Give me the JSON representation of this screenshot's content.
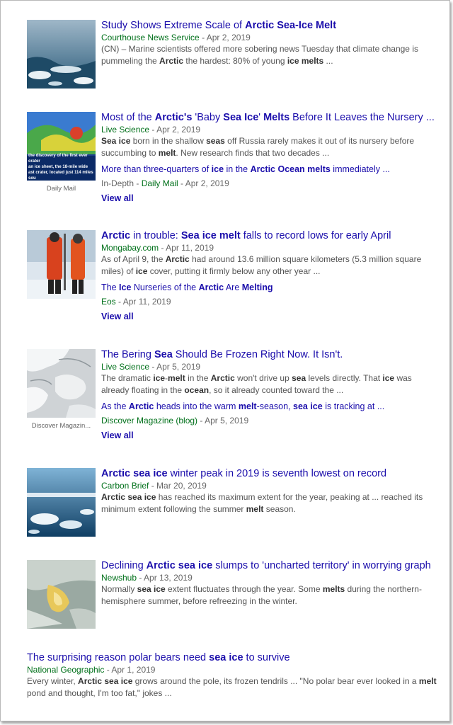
{
  "results": [
    {
      "title_parts": [
        [
          "Study Shows Extreme Scale of ",
          false
        ],
        [
          "Arctic Sea-Ice Melt",
          true
        ]
      ],
      "publisher": "Courthouse News Service",
      "date": "Apr 2, 2019",
      "snippet_parts": [
        [
          "(CN) – Marine scientists offered more sobering news Tuesday that climate change is pummeling the ",
          false
        ],
        [
          "Arctic",
          true
        ],
        [
          " the hardest: 80% of young ",
          false
        ],
        [
          "ice melts",
          true
        ],
        [
          " ...",
          false
        ]
      ]
    },
    {
      "title_parts": [
        [
          "Most of the ",
          false
        ],
        [
          "Arctic's",
          true
        ],
        [
          " 'Baby ",
          false
        ],
        [
          "Sea Ice",
          true
        ],
        [
          "' ",
          false
        ],
        [
          "Melts",
          true
        ],
        [
          " Before It Leaves the Nursery ...",
          false
        ]
      ],
      "publisher": "Live Science",
      "date": "Apr 2, 2019",
      "snippet_parts": [
        [
          "Sea ice",
          true
        ],
        [
          " born in the shallow ",
          false
        ],
        [
          "seas",
          true
        ],
        [
          " off Russia rarely makes it out of its nursery before succumbing to ",
          false
        ],
        [
          "melt",
          true
        ],
        [
          ". New research finds that two decades ...",
          false
        ]
      ],
      "thumb_caption": "Daily Mail",
      "sub_title_parts": [
        [
          "More than three-quarters of ",
          false
        ],
        [
          "ice",
          true
        ],
        [
          " in the ",
          false
        ],
        [
          "Arctic Ocean melts",
          true
        ],
        [
          " immediately ...",
          false
        ]
      ],
      "sub_prefix": "In-Depth",
      "sub_publisher": "Daily Mail",
      "sub_date": "Apr 2, 2019",
      "view_all": "View all"
    },
    {
      "title_parts": [
        [
          "Arctic",
          true
        ],
        [
          " in trouble: ",
          false
        ],
        [
          "Sea ice melt",
          true
        ],
        [
          " falls to record lows for early April",
          false
        ]
      ],
      "publisher": "Mongabay.com",
      "date": "Apr 11, 2019",
      "snippet_parts": [
        [
          "As of April 9, the ",
          false
        ],
        [
          "Arctic",
          true
        ],
        [
          " had around 13.6 million square kilometers (5.3 million square miles) of ",
          false
        ],
        [
          "ice",
          true
        ],
        [
          " cover, putting it firmly below any other year ...",
          false
        ]
      ],
      "sub_title_parts": [
        [
          "The ",
          false
        ],
        [
          "Ice",
          true
        ],
        [
          " Nurseries of the ",
          false
        ],
        [
          "Arctic",
          true
        ],
        [
          " Are ",
          false
        ],
        [
          "Melting",
          true
        ]
      ],
      "sub_publisher": "Eos",
      "sub_date": "Apr 11, 2019",
      "view_all": "View all"
    },
    {
      "title_parts": [
        [
          "The Bering ",
          false
        ],
        [
          "Sea",
          true
        ],
        [
          " Should Be Frozen Right Now. It Isn't.",
          false
        ]
      ],
      "publisher": "Live Science",
      "date": "Apr 5, 2019",
      "snippet_parts": [
        [
          "The dramatic ",
          false
        ],
        [
          "ice",
          true
        ],
        [
          "-",
          false
        ],
        [
          "melt",
          true
        ],
        [
          " in the ",
          false
        ],
        [
          "Arctic",
          true
        ],
        [
          " won't drive up ",
          false
        ],
        [
          "sea",
          true
        ],
        [
          " levels directly. That ",
          false
        ],
        [
          "ice",
          true
        ],
        [
          " was already floating in the ",
          false
        ],
        [
          "ocean",
          true
        ],
        [
          ", so it already counted toward the ...",
          false
        ]
      ],
      "thumb_caption": "Discover Magazin...",
      "sub_title_parts": [
        [
          "As the ",
          false
        ],
        [
          "Arctic",
          true
        ],
        [
          " heads into the warm ",
          false
        ],
        [
          "melt",
          true
        ],
        [
          "-season, ",
          false
        ],
        [
          "sea ice",
          true
        ],
        [
          " is tracking at ...",
          false
        ]
      ],
      "sub_publisher": "Discover Magazine (blog)",
      "sub_date": "Apr 5, 2019",
      "view_all": "View all"
    },
    {
      "title_parts": [
        [
          "Arctic sea ice",
          true
        ],
        [
          " winter peak in 2019 is seventh lowest on record",
          false
        ]
      ],
      "publisher": "Carbon Brief",
      "date": "Mar 20, 2019",
      "snippet_parts": [
        [
          "Arctic sea ice",
          true
        ],
        [
          " has reached its maximum extent for the year, peaking at ... reached its minimum extent following the summer ",
          false
        ],
        [
          "melt",
          true
        ],
        [
          " season.",
          false
        ]
      ]
    },
    {
      "title_parts": [
        [
          "Declining ",
          false
        ],
        [
          "Arctic sea ice",
          true
        ],
        [
          " slumps to 'uncharted territory' in worrying graph",
          false
        ]
      ],
      "publisher": "Newshub",
      "date": "Apr 13, 2019",
      "snippet_parts": [
        [
          "Normally ",
          false
        ],
        [
          "sea ice",
          true
        ],
        [
          " extent fluctuates through the year. Some ",
          false
        ],
        [
          "melts",
          true
        ],
        [
          " during the northern-hemisphere summer, before refreezing in the winter.",
          false
        ]
      ]
    },
    {
      "title_parts": [
        [
          "The surprising reason polar bears need ",
          false
        ],
        [
          "sea ice",
          true
        ],
        [
          " to survive",
          false
        ]
      ],
      "publisher": "National Geographic",
      "date": "Apr 1, 2019",
      "snippet_parts": [
        [
          "Every winter, ",
          false
        ],
        [
          "Arctic sea ice",
          true
        ],
        [
          " grows around the pole, its frozen tendrils ... \"No polar bear ever looked in a ",
          false
        ],
        [
          "melt",
          true
        ],
        [
          " pond and thought, I'm too fat,\" jokes ...",
          false
        ]
      ]
    }
  ],
  "date_separator": " - ",
  "thumb2_text": [
    "the discovery of the first ever crater",
    "an ice sheet, the 18-mile wide",
    "ast crater, located just 114 miles sou"
  ],
  "colors": {
    "link": "#1a0dab",
    "publisher": "#00701a",
    "meta": "#666666",
    "snippet": "#545454"
  },
  "icons": [
    "thumbnail-image"
  ]
}
